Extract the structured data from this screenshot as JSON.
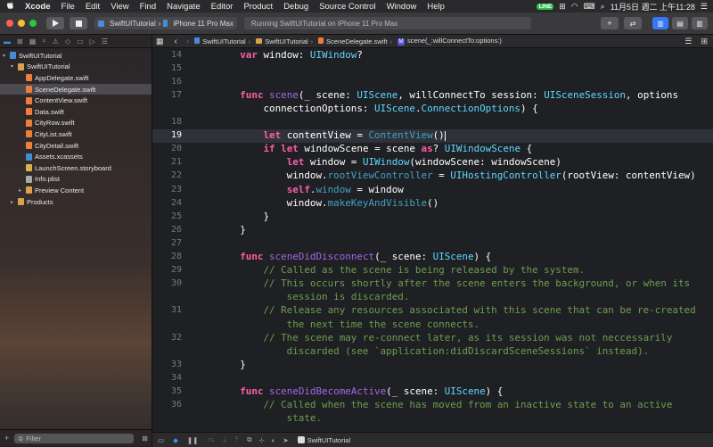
{
  "menubar": {
    "apple": "",
    "app": "Xcode",
    "items": [
      "File",
      "Edit",
      "View",
      "Find",
      "Navigate",
      "Editor",
      "Product",
      "Debug",
      "Source Control",
      "Window",
      "Help"
    ],
    "badge": "LINE",
    "clock": "11月5日 週二 上午11:28"
  },
  "toolbar": {
    "scheme": "SwiftUITutorial",
    "device": "iPhone 11 Pro Max",
    "status": "Running SwiftUITutorial on iPhone 11 Pro Max"
  },
  "navigator": {
    "tree": [
      {
        "label": "SwiftUITutorial",
        "depth": 0,
        "icon": "proj",
        "disc": "▾"
      },
      {
        "label": "SwiftUITutorial",
        "depth": 1,
        "icon": "folder",
        "disc": "▾"
      },
      {
        "label": "AppDelegate.swift",
        "depth": 2,
        "icon": "swift",
        "disc": ""
      },
      {
        "label": "SceneDelegate.swift",
        "depth": 2,
        "icon": "swift",
        "disc": "",
        "selected": true
      },
      {
        "label": "ContentView.swift",
        "depth": 2,
        "icon": "swift",
        "disc": ""
      },
      {
        "label": "Data.swift",
        "depth": 2,
        "icon": "swift",
        "disc": ""
      },
      {
        "label": "CityRow.swift",
        "depth": 2,
        "icon": "swift",
        "disc": ""
      },
      {
        "label": "CityList.swift",
        "depth": 2,
        "icon": "swift",
        "disc": ""
      },
      {
        "label": "CityDetail.swift",
        "depth": 2,
        "icon": "swift",
        "disc": ""
      },
      {
        "label": "Assets.xcassets",
        "depth": 2,
        "icon": "assets",
        "disc": ""
      },
      {
        "label": "LaunchScreen.storyboard",
        "depth": 2,
        "icon": "story",
        "disc": ""
      },
      {
        "label": "Info.plist",
        "depth": 2,
        "icon": "plist",
        "disc": ""
      },
      {
        "label": "Preview Content",
        "depth": 2,
        "icon": "folder",
        "disc": "▸"
      },
      {
        "label": "Products",
        "depth": 1,
        "icon": "folder",
        "disc": "▸"
      }
    ],
    "filter_placeholder": "Filter"
  },
  "jumpbar": {
    "crumbs": [
      "SwiftUITutorial",
      "SwiftUITutorial",
      "SceneDelegate.swift",
      "scene(_:willConnectTo:options:)"
    ]
  },
  "editor": {
    "current_line": "19",
    "lines": [
      {
        "n": "14",
        "parts": [
          [
            "    ",
            ""
          ],
          [
            "var",
            "kw"
          ],
          [
            " window: ",
            ""
          ],
          [
            "UIWindow",
            "ty"
          ],
          [
            "?",
            ""
          ]
        ]
      },
      {
        "n": "15",
        "parts": []
      },
      {
        "n": "16",
        "parts": []
      },
      {
        "n": "17",
        "parts": [
          [
            "    ",
            ""
          ],
          [
            "func",
            "kw"
          ],
          [
            " ",
            ""
          ],
          [
            "scene",
            "mt"
          ],
          [
            "(_ scene: ",
            ""
          ],
          [
            "UIScene",
            "ty"
          ],
          [
            ", willConnectTo session: ",
            ""
          ],
          [
            "UISceneSession",
            "ty"
          ],
          [
            ", options",
            ""
          ]
        ]
      },
      {
        "n": "",
        "parts": [
          [
            "        connectionOptions: ",
            ""
          ],
          [
            "UIScene",
            "ty"
          ],
          [
            ".",
            ""
          ],
          [
            "ConnectionOptions",
            "ty"
          ],
          [
            ") {",
            ""
          ]
        ]
      },
      {
        "n": "18",
        "parts": []
      },
      {
        "n": "19",
        "parts": [
          [
            "        ",
            ""
          ],
          [
            "let",
            "kw"
          ],
          [
            " contentView = ",
            ""
          ],
          [
            "ContentView",
            "tc"
          ],
          [
            "()",
            ""
          ]
        ]
      },
      {
        "n": "20",
        "parts": [
          [
            "        ",
            ""
          ],
          [
            "if",
            "kw"
          ],
          [
            " ",
            ""
          ],
          [
            "let",
            "kw"
          ],
          [
            " windowScene = scene ",
            ""
          ],
          [
            "as",
            "kw"
          ],
          [
            "? ",
            ""
          ],
          [
            "UIWindowScene",
            "ty"
          ],
          [
            " {",
            ""
          ]
        ]
      },
      {
        "n": "21",
        "parts": [
          [
            "            ",
            ""
          ],
          [
            "let",
            "kw"
          ],
          [
            " window = ",
            ""
          ],
          [
            "UIWindow",
            "ty"
          ],
          [
            "(windowScene: windowScene)",
            ""
          ]
        ]
      },
      {
        "n": "22",
        "parts": [
          [
            "            window.",
            ""
          ],
          [
            "rootViewController",
            "tc"
          ],
          [
            " = ",
            ""
          ],
          [
            "UIHostingController",
            "ty"
          ],
          [
            "(rootView: contentView)",
            ""
          ]
        ]
      },
      {
        "n": "23",
        "parts": [
          [
            "            ",
            ""
          ],
          [
            "self",
            "kw"
          ],
          [
            ".",
            ""
          ],
          [
            "window",
            "tc"
          ],
          [
            " = window",
            ""
          ]
        ]
      },
      {
        "n": "24",
        "parts": [
          [
            "            window.",
            ""
          ],
          [
            "makeKeyAndVisible",
            "tc"
          ],
          [
            "()",
            ""
          ]
        ]
      },
      {
        "n": "25",
        "parts": [
          [
            "        }",
            ""
          ]
        ]
      },
      {
        "n": "26",
        "parts": [
          [
            "    }",
            ""
          ]
        ]
      },
      {
        "n": "27",
        "parts": []
      },
      {
        "n": "28",
        "parts": [
          [
            "    ",
            ""
          ],
          [
            "func",
            "kw"
          ],
          [
            " ",
            ""
          ],
          [
            "sceneDidDisconnect",
            "mt"
          ],
          [
            "(_ scene: ",
            ""
          ],
          [
            "UIScene",
            "ty"
          ],
          [
            ") {",
            ""
          ]
        ]
      },
      {
        "n": "29",
        "parts": [
          [
            "        // Called as the scene is being released by the system.",
            "cm"
          ]
        ]
      },
      {
        "n": "30",
        "parts": [
          [
            "        // This occurs shortly after the scene enters the background, or when its",
            "cm"
          ]
        ]
      },
      {
        "n": "",
        "parts": [
          [
            "            session is discarded.",
            "cm"
          ]
        ]
      },
      {
        "n": "31",
        "parts": [
          [
            "        // Release any resources associated with this scene that can be re-created",
            "cm"
          ]
        ]
      },
      {
        "n": "",
        "parts": [
          [
            "            the next time the scene connects.",
            "cm"
          ]
        ]
      },
      {
        "n": "32",
        "parts": [
          [
            "        // The scene may re-connect later, as its session was not neccessarily",
            "cm"
          ]
        ]
      },
      {
        "n": "",
        "parts": [
          [
            "            discarded (see `application:didDiscardSceneSessions` instead).",
            "cm"
          ]
        ]
      },
      {
        "n": "33",
        "parts": [
          [
            "    }",
            ""
          ]
        ]
      },
      {
        "n": "34",
        "parts": []
      },
      {
        "n": "35",
        "parts": [
          [
            "    ",
            ""
          ],
          [
            "func",
            "kw"
          ],
          [
            " ",
            ""
          ],
          [
            "sceneDidBecomeActive",
            "mt"
          ],
          [
            "(_ scene: ",
            ""
          ],
          [
            "UIScene",
            "ty"
          ],
          [
            ") {",
            ""
          ]
        ]
      },
      {
        "n": "36",
        "parts": [
          [
            "        // Called when the scene has moved from an inactive state to an active",
            "cm"
          ]
        ]
      },
      {
        "n": "",
        "parts": [
          [
            "            state.",
            "cm"
          ]
        ]
      }
    ]
  },
  "debugbar": {
    "target": "SwiftUITutorial"
  }
}
